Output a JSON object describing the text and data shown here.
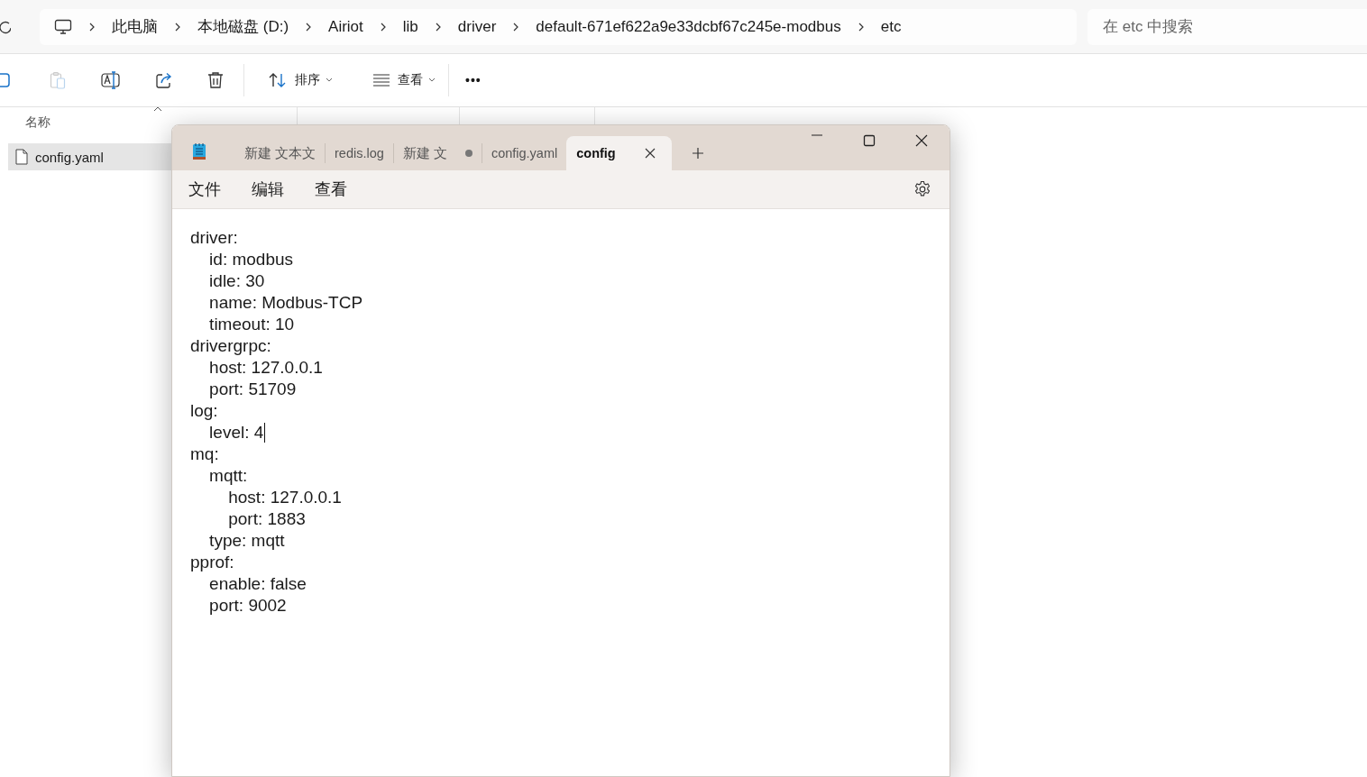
{
  "explorer": {
    "breadcrumb": [
      "此电脑",
      "本地磁盘 (D:)",
      "Airiot",
      "lib",
      "driver",
      "default-671ef622a9e33dcbf67c245e-modbus",
      "etc"
    ],
    "search": {
      "placeholder": "在 etc 中搜索"
    },
    "toolbar": [
      {
        "kind": "copy",
        "disabled": false
      },
      {
        "kind": "paste",
        "disabled": true
      },
      {
        "kind": "rename",
        "disabled": false
      },
      {
        "kind": "share",
        "disabled": false
      },
      {
        "kind": "delete",
        "disabled": false
      },
      {
        "kind": "sort",
        "label": "排序"
      },
      {
        "kind": "view",
        "label": "查看"
      },
      {
        "kind": "more",
        "label": "•••"
      }
    ],
    "columns": [
      "名称"
    ],
    "files": [
      {
        "name": "config.yaml",
        "selected": true
      }
    ]
  },
  "notepad": {
    "tabs": [
      {
        "label": "新建 文本文",
        "selected": false,
        "modified": false
      },
      {
        "label": "redis.log",
        "selected": false,
        "modified": false
      },
      {
        "label": "新建 文",
        "selected": false,
        "modified": true
      },
      {
        "label": "config.yaml",
        "selected": false,
        "modified": false
      },
      {
        "label": "config",
        "selected": true,
        "modified": false
      }
    ],
    "menu": [
      "文件",
      "编辑",
      "查看"
    ],
    "lines": [
      {
        "text": "driver:",
        "cursor": false
      },
      {
        "text": "    id: modbus",
        "cursor": false
      },
      {
        "text": "    idle: 30",
        "cursor": false
      },
      {
        "text": "    name: Modbus-TCP",
        "cursor": false
      },
      {
        "text": "    timeout: 10",
        "cursor": false
      },
      {
        "text": "drivergrpc:",
        "cursor": false
      },
      {
        "text": "    host: 127.0.0.1",
        "cursor": false
      },
      {
        "text": "    port: 51709",
        "cursor": false
      },
      {
        "text": "log:",
        "cursor": false
      },
      {
        "text": "    level: 4",
        "cursor": true
      },
      {
        "text": "mq:",
        "cursor": false
      },
      {
        "text": "    mqtt:",
        "cursor": false
      },
      {
        "text": "        host: 127.0.0.1",
        "cursor": false
      },
      {
        "text": "        port: 1883",
        "cursor": false
      },
      {
        "text": "    type: mqtt",
        "cursor": false
      },
      {
        "text": "pprof:",
        "cursor": false
      },
      {
        "text": "    enable: false",
        "cursor": false
      },
      {
        "text": "    port: 9002",
        "cursor": false
      }
    ]
  }
}
